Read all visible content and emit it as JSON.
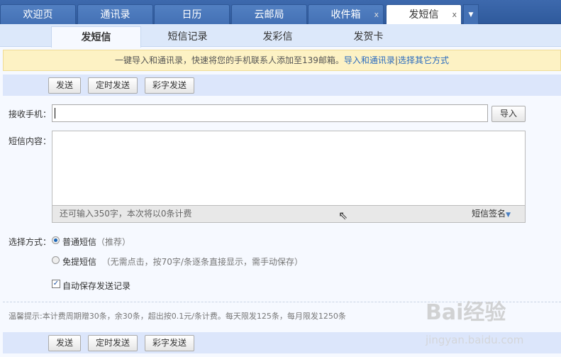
{
  "top_tabs": [
    {
      "label": "欢迎页"
    },
    {
      "label": "通讯录"
    },
    {
      "label": "日历"
    },
    {
      "label": "云邮局"
    },
    {
      "label": "收件箱",
      "closable": true
    },
    {
      "label": "发短信",
      "closable": true,
      "active": true
    }
  ],
  "close_glyph": "x",
  "sub_tabs": [
    {
      "label": "发短信",
      "active": true
    },
    {
      "label": "短信记录"
    },
    {
      "label": "发彩信"
    },
    {
      "label": "发贺卡"
    }
  ],
  "notice": {
    "text": "一键导入和通讯录，快速将您的手机联系人添加至139邮箱。",
    "link1": "导入和通讯录",
    "sep": "|",
    "link2": "选择其它方式"
  },
  "toolbar": {
    "send": "发送",
    "scheduled": "定时发送",
    "color_send": "彩字发送"
  },
  "form": {
    "receiver_label": "接收手机：",
    "receiver_value": "",
    "import_button": "导入",
    "content_label": "短信内容：",
    "content_value": "",
    "counter": "还可输入350字，本次将以0条计费",
    "signature": "短信签名",
    "mode_label": "选择方式：",
    "mode_normal": "普通短信",
    "mode_normal_note": "（推荐）",
    "mode_flash": "免提短信",
    "mode_flash_note": "（无需点击，按70字/条逐条直接显示，需手动保存）",
    "selected_mode": "普通短信",
    "autosave_label": "自动保存发送记录",
    "autosave_checked": true
  },
  "tip": "温馨提示:本计费周期赠30条，余30条，超出按0.1元/条计费。每天限发125条，每月限发1250条",
  "watermark": {
    "brand": "Bai经验",
    "url": "jingyan.baidu.com"
  },
  "colors": {
    "topbar": "#3d69ad",
    "link": "#2a6bbf",
    "notice_bg": "#fdf2c4"
  }
}
